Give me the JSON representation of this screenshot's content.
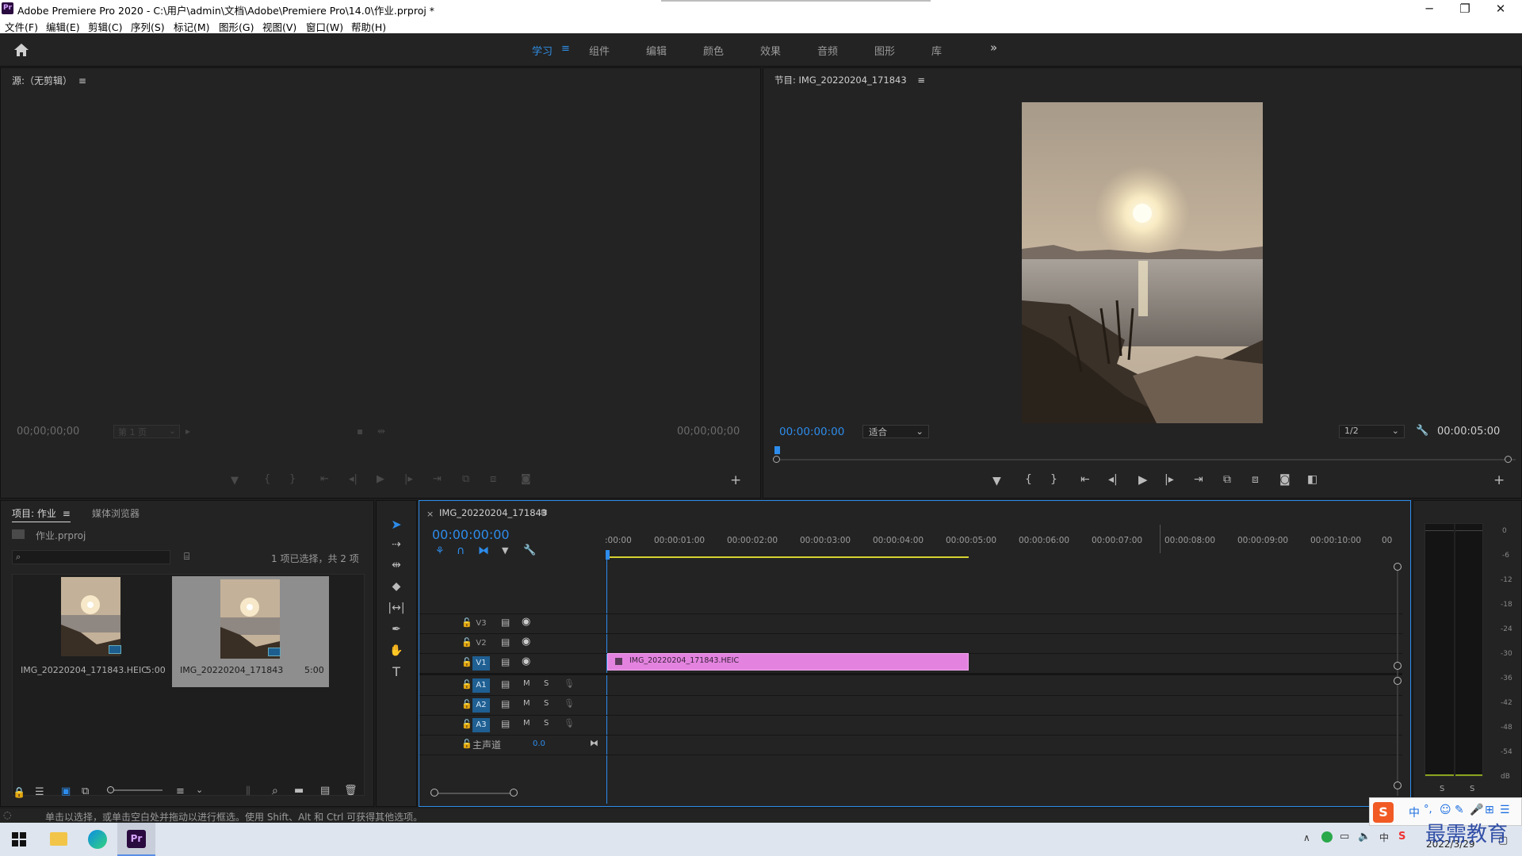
{
  "window": {
    "title": "Adobe Premiere Pro 2020 - C:\\用户\\admin\\文档\\Adobe\\Premiere Pro\\14.0\\作业.prproj *",
    "app_icon": "Pr",
    "minimize": "─",
    "maximize": "❐",
    "close": "✕"
  },
  "menu": [
    "文件(F)",
    "编辑(E)",
    "剪辑(C)",
    "序列(S)",
    "标记(M)",
    "图形(G)",
    "视图(V)",
    "窗口(W)",
    "帮助(H)"
  ],
  "workspaces": {
    "items": [
      "学习",
      "组件",
      "编辑",
      "颜色",
      "效果",
      "音频",
      "图形",
      "库"
    ],
    "active": "学习",
    "more": "»"
  },
  "source_monitor": {
    "title": "源:（无剪辑）",
    "timecode_left": "00;00;00;00",
    "page_select": "第 1 页",
    "timecode_right": "00;00;00;00"
  },
  "program_monitor": {
    "title": "节目: IMG_20220204_171843",
    "timecode": "00:00:00:00",
    "fit": "适合",
    "resolution": "1/2",
    "duration": "00:00:05:00"
  },
  "project_panel": {
    "tab_project": "项目: 作业",
    "tab_media": "媒体浏览器",
    "file": "作业.prproj",
    "selection_info": "1 项已选择，共 2 项",
    "search_placeholder": "",
    "items": [
      {
        "name": "IMG_20220204_171843.HEIC",
        "duration": "5:00",
        "selected": false
      },
      {
        "name": "IMG_20220204_171843",
        "duration": "5:00",
        "selected": true
      }
    ]
  },
  "timeline": {
    "sequence_name": "IMG_20220204_171843",
    "timecode": "00:00:00:00",
    "ruler": [
      ":00:00",
      "00:00:01:00",
      "00:00:02:00",
      "00:00:03:00",
      "00:00:04:00",
      "00:00:05:00",
      "00:00:06:00",
      "00:00:07:00",
      "00:00:08:00",
      "00:00:09:00",
      "00:00:10:00",
      "00"
    ],
    "video_tracks": [
      "V3",
      "V2",
      "V1"
    ],
    "audio_tracks": [
      "A1",
      "A2",
      "A3"
    ],
    "mute_label": "M",
    "solo_label": "S",
    "master_label": "主声道",
    "master_value": "0.0",
    "clip_name": "IMG_20220204_171843.HEIC",
    "clip_color": "#e383df"
  },
  "audio_meter": {
    "scale": [
      "0",
      "-6",
      "-12",
      "-18",
      "-24",
      "-30",
      "-36",
      "-42",
      "-48",
      "-54",
      "dB"
    ],
    "solo_left": "S",
    "solo_right": "S"
  },
  "status_bar": {
    "text": "单击以选择，或单击空白处并拖动以进行框选。使用 Shift、Alt 和 Ctrl 可获得其他选项。"
  },
  "taskbar": {
    "date": "2022/3/29",
    "ime": "中",
    "watermark": "最需教育"
  },
  "colors": {
    "accent_blue": "#2d8ceb",
    "panel_bg": "#232323",
    "clip_pink": "#e383df",
    "selected_track": "#1f5f92"
  }
}
